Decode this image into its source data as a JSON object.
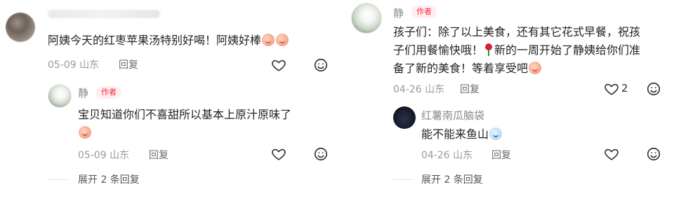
{
  "left": {
    "comment1": {
      "text": "阿姨今天的红枣苹果汤特别好喝！阿姨好棒",
      "emoji": [
        "emoji-smile",
        "emoji-smile"
      ],
      "date": "05-09",
      "location": "山东",
      "reply": "回复"
    },
    "reply1": {
      "author": "静",
      "badge": "作者",
      "text": "宝贝知道你们不喜甜所以基本上原汁原味了",
      "date": "05-09",
      "location": "山东",
      "reply": "回复"
    },
    "expand": "展开 2 条回复"
  },
  "right": {
    "comment1": {
      "author": "静",
      "badge": "作者",
      "line1": "孩子们：除了以上美食，还有其它花式早餐，祝孩",
      "line2a": "子们用餐愉快哦！",
      "line2b": "新的一周开始了静姨给你们准",
      "line3": "备了新的美食！等着享受吧",
      "date": "04-26",
      "location": "山东",
      "reply": "回复",
      "like_count": "2"
    },
    "reply1": {
      "author": "红薯南瓜脑袋",
      "text": "能不能来鱼山",
      "date": "04-26",
      "location": "山东",
      "reply": "回复"
    },
    "expand": "展开 2 条回复"
  },
  "icons": {
    "like": "heart-outline-icon",
    "emoji_reply": "emoji-face-icon",
    "rose": "rose-icon"
  }
}
